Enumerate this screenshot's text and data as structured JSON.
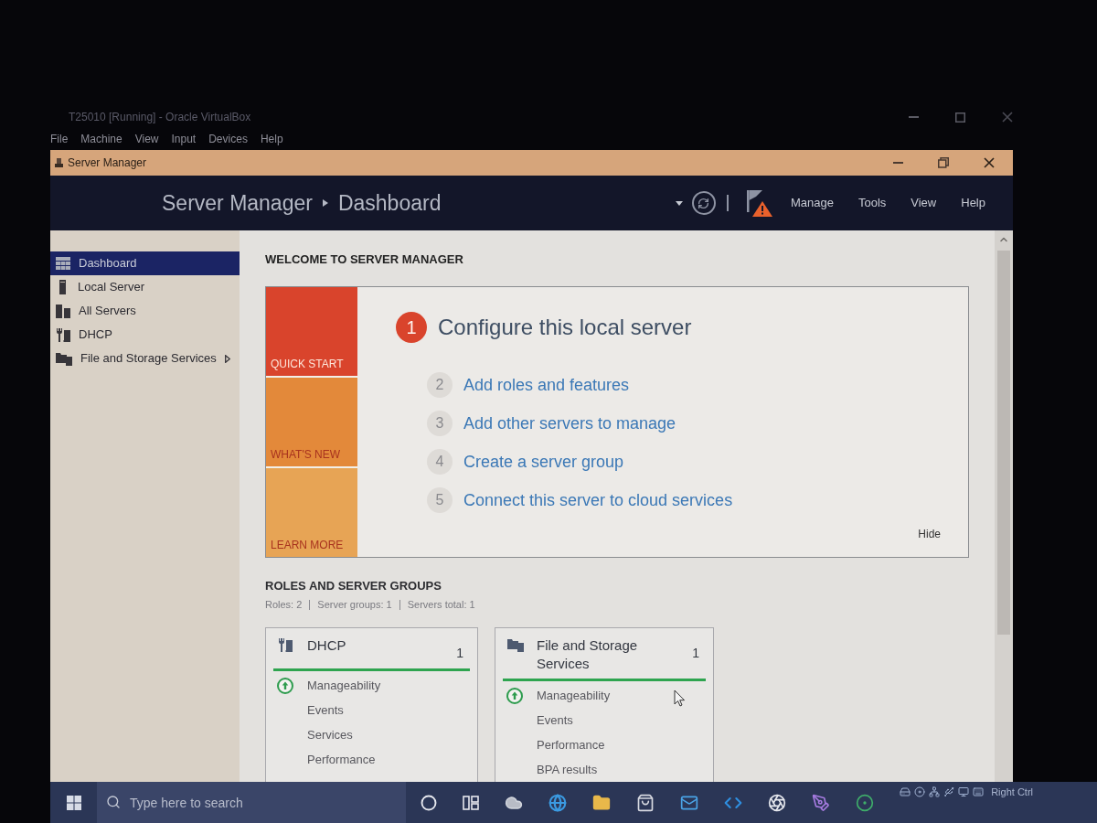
{
  "host_window": {
    "title": "T25010 [Running] - Oracle VirtualBox",
    "menu": [
      "File",
      "Machine",
      "View",
      "Input",
      "Devices",
      "Help"
    ]
  },
  "app_window": {
    "title": "Server Manager"
  },
  "header": {
    "breadcrumb": [
      "Server Manager",
      "Dashboard"
    ],
    "notification_warning": true,
    "menu": [
      "Manage",
      "Tools",
      "View",
      "Help"
    ]
  },
  "sidebar": {
    "items": [
      {
        "label": "Dashboard",
        "selected": true,
        "has_submenu": false
      },
      {
        "label": "Local Server",
        "selected": false,
        "has_submenu": false
      },
      {
        "label": "All Servers",
        "selected": false,
        "has_submenu": false
      },
      {
        "label": "DHCP",
        "selected": false,
        "has_submenu": false
      },
      {
        "label": "File and Storage Services",
        "selected": false,
        "has_submenu": true
      }
    ]
  },
  "welcome": {
    "title": "WELCOME TO SERVER MANAGER",
    "tiles": [
      {
        "label": "QUICK START",
        "selected": true,
        "color": "#d9442c"
      },
      {
        "label": "WHAT'S NEW",
        "selected": false,
        "color": "#e3893a"
      },
      {
        "label": "LEARN MORE",
        "selected": false,
        "color": "#e7a455"
      }
    ],
    "steps": [
      {
        "number": "1",
        "label": "Configure this local server",
        "selected": true
      },
      {
        "number": "2",
        "label": "Add roles and features",
        "selected": false
      },
      {
        "number": "3",
        "label": "Add other servers to manage",
        "selected": false
      },
      {
        "number": "4",
        "label": "Create a server group",
        "selected": false
      },
      {
        "number": "5",
        "label": "Connect this server to cloud services",
        "selected": false
      }
    ],
    "hide": "Hide"
  },
  "roles": {
    "title": "ROLES AND SERVER GROUPS",
    "summary": [
      "Roles: 2",
      "Server groups: 1",
      "Servers total: 1"
    ],
    "cards": [
      {
        "title": "DHCP",
        "count": "1",
        "healthy": true,
        "rows": [
          {
            "label": "Manageability",
            "ok": true
          },
          {
            "label": "Events",
            "ok": false
          },
          {
            "label": "Services",
            "ok": false
          },
          {
            "label": "Performance",
            "ok": false
          }
        ]
      },
      {
        "title": "File and Storage Services",
        "count": "1",
        "healthy": true,
        "rows": [
          {
            "label": "Manageability",
            "ok": true
          },
          {
            "label": "Events",
            "ok": false
          },
          {
            "label": "Performance",
            "ok": false
          },
          {
            "label": "BPA results",
            "ok": false
          }
        ]
      }
    ]
  },
  "taskbar": {
    "search": {
      "placeholder": "Type here to search"
    },
    "host_key": "Right Ctrl"
  }
}
